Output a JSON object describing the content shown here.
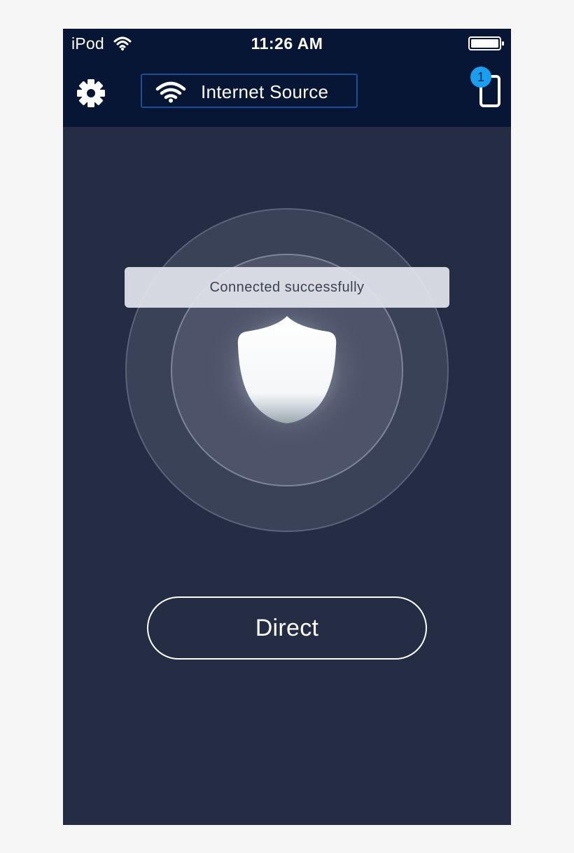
{
  "status_bar": {
    "carrier": "iPod",
    "time": "11:26 AM"
  },
  "header": {
    "source_label": "Internet Source",
    "device_count": "1"
  },
  "toast": {
    "message": "Connected successfully"
  },
  "mode_button": {
    "label": "Direct"
  },
  "icons": {
    "status_wifi": "wifi-icon",
    "battery": "battery-full-icon",
    "settings": "gear-icon",
    "source": "wifi-icon",
    "device": "phone-icon",
    "center": "shield-icon"
  },
  "colors": {
    "background": "#252d44",
    "header": "#071634",
    "source_border": "#1c4e92",
    "badge": "#1a9ff0",
    "page": "#f6f6f6"
  }
}
